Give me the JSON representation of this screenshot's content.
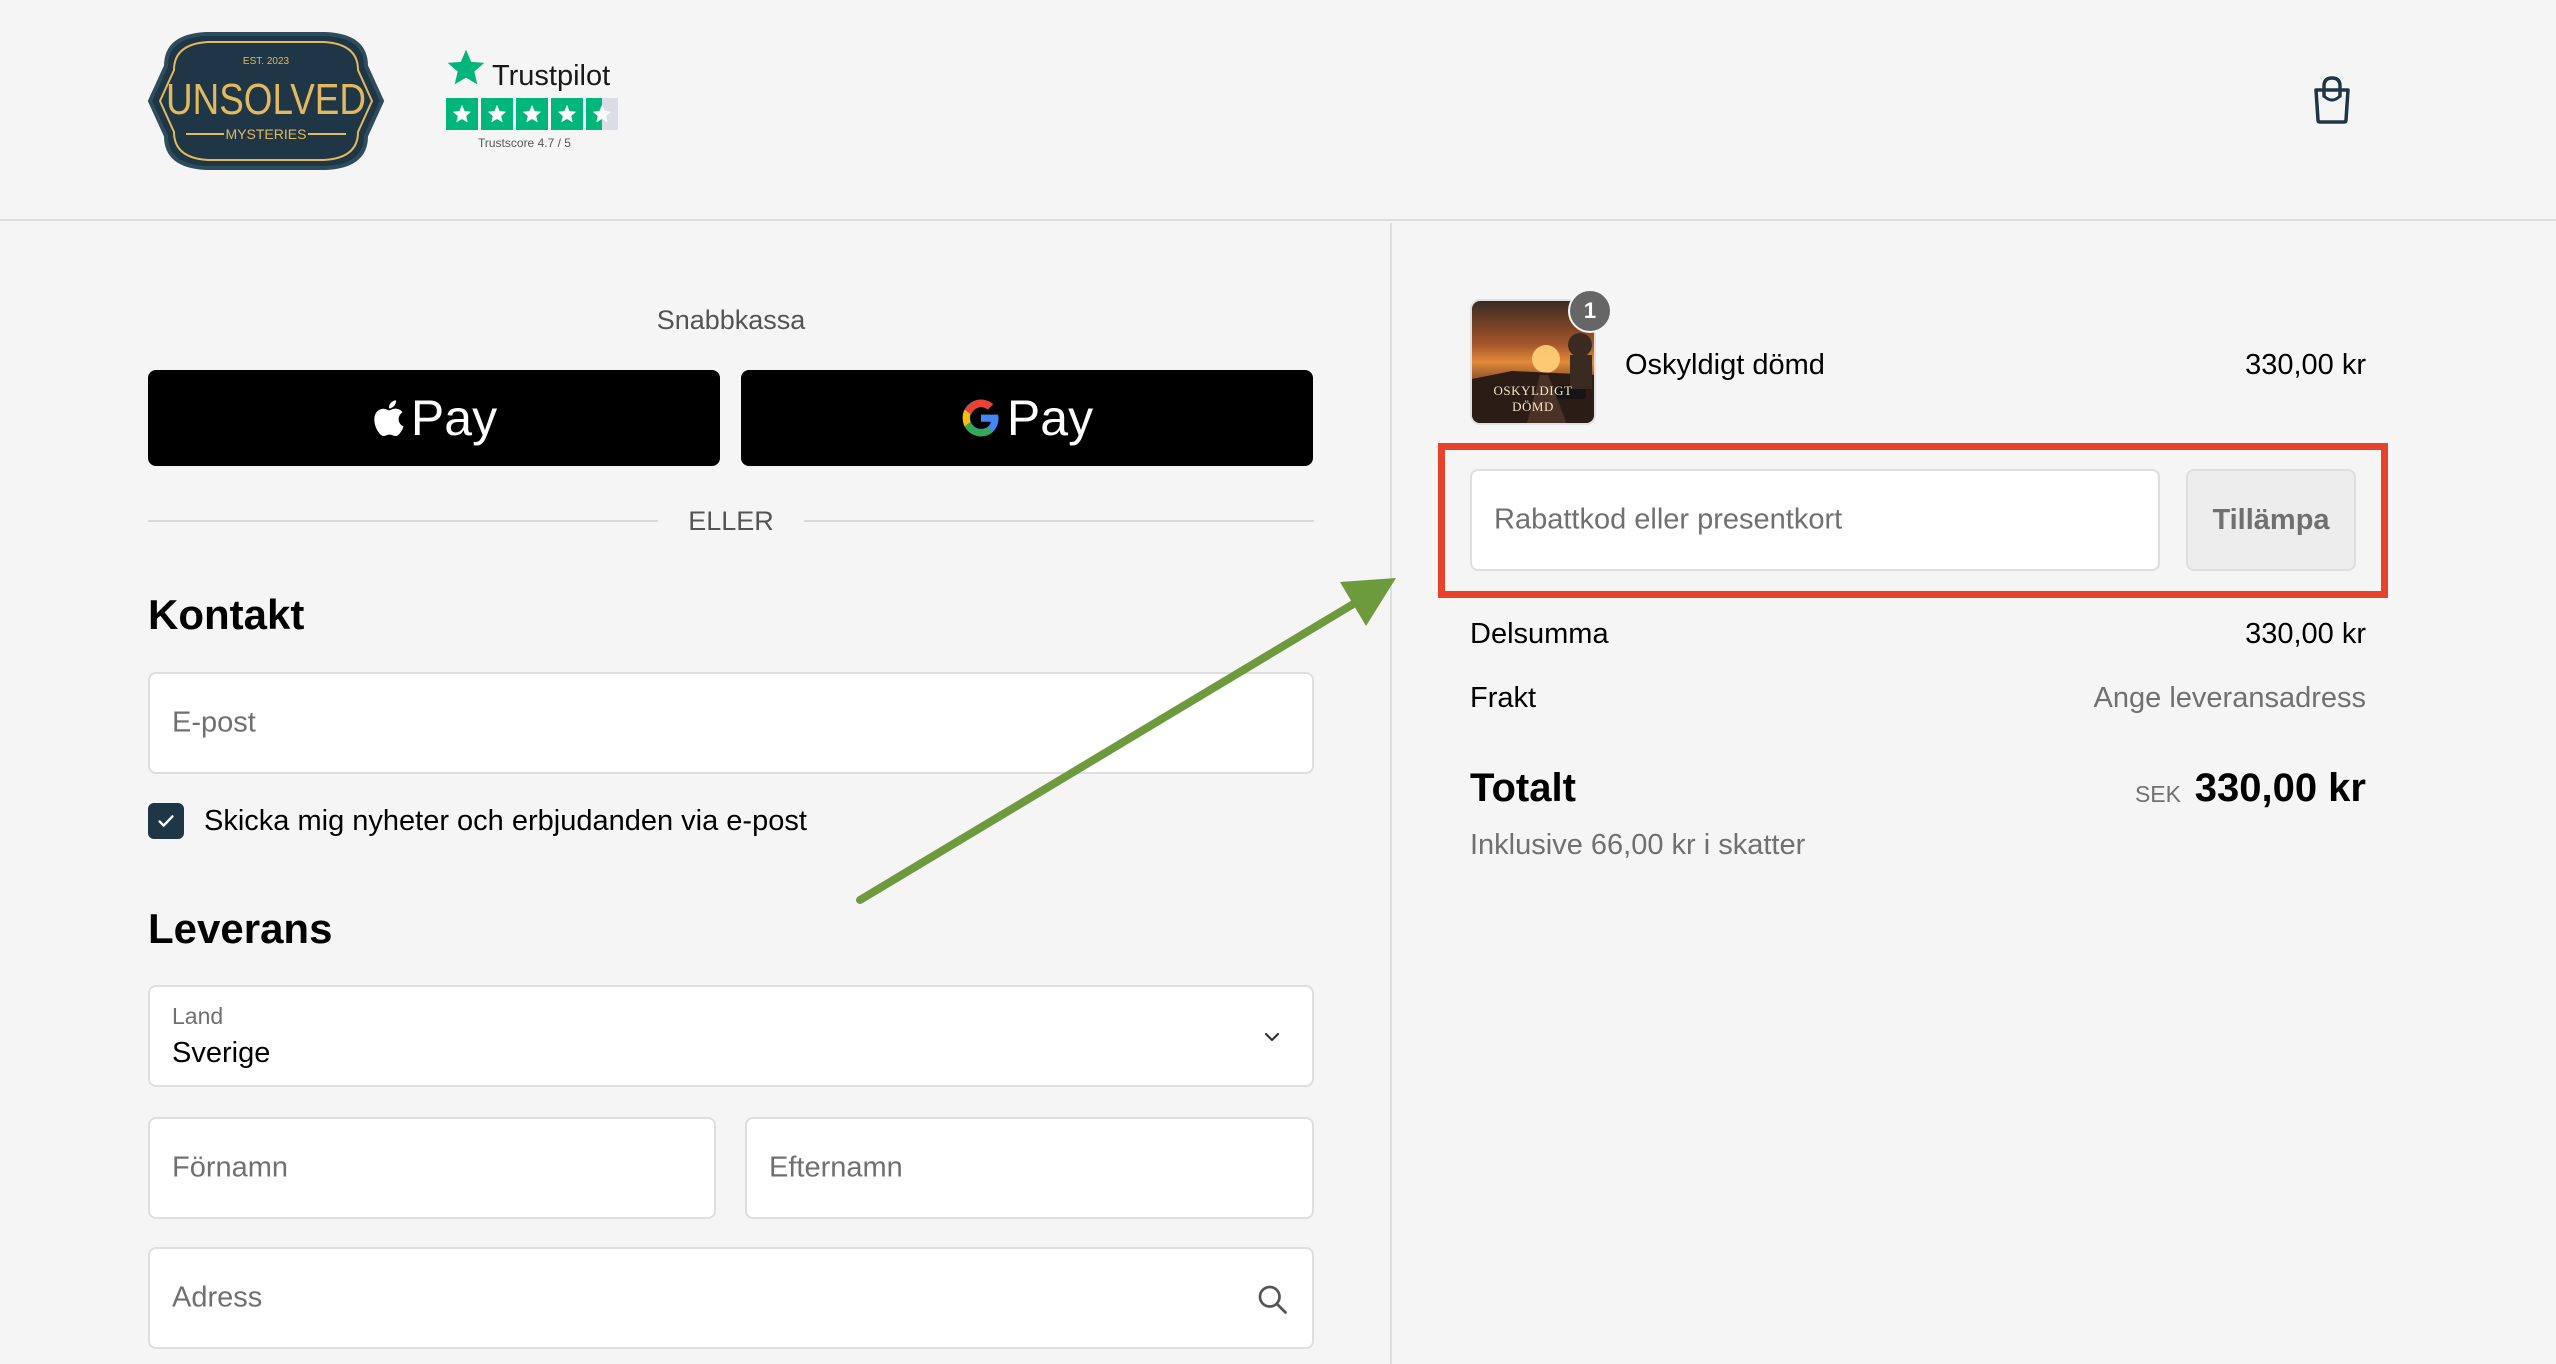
{
  "brand": {
    "logo_top": "EST. 2023",
    "logo_main": "UNSOLVED",
    "logo_sub": "MYSTERIES",
    "colors": {
      "navy": "#1f3646",
      "gold": "#e2b95f"
    }
  },
  "trustpilot": {
    "name": "Trustpilot",
    "score_text": "Trustscore 4.7 / 5",
    "rating": 4.7,
    "color": "#00b67a"
  },
  "header": {
    "cart_icon": "shopping-bag-icon"
  },
  "express": {
    "title": "Snabbkassa",
    "apple_pay_label": "Pay",
    "google_pay_label": "Pay",
    "divider": "ELLER"
  },
  "contact": {
    "title": "Kontakt",
    "email_placeholder": "E-post",
    "newsletter_label": "Skicka mig nyheter och erbjudanden via e-post",
    "newsletter_checked": true
  },
  "delivery": {
    "title": "Leverans",
    "country_label": "Land",
    "country_value": "Sverige",
    "first_name_placeholder": "Förnamn",
    "last_name_placeholder": "Efternamn",
    "address_placeholder": "Adress"
  },
  "summary": {
    "product": {
      "name": "Oskyldigt dömd",
      "price": "330,00 kr",
      "quantity": "1",
      "thumb_text": "OSKYLDIGT DÖMD"
    },
    "discount_placeholder": "Rabattkod eller presentkort",
    "apply_label": "Tillämpa",
    "subtotal_label": "Delsumma",
    "subtotal_value": "330,00 kr",
    "shipping_label": "Frakt",
    "shipping_value": "Ange leveransadress",
    "total_label": "Totalt",
    "total_currency": "SEK",
    "total_value": "330,00 kr",
    "tax_note": "Inklusive 66,00 kr i skatter"
  },
  "annotation": {
    "highlight_color": "#e8422b",
    "arrow_color": "#6e9a3e"
  }
}
